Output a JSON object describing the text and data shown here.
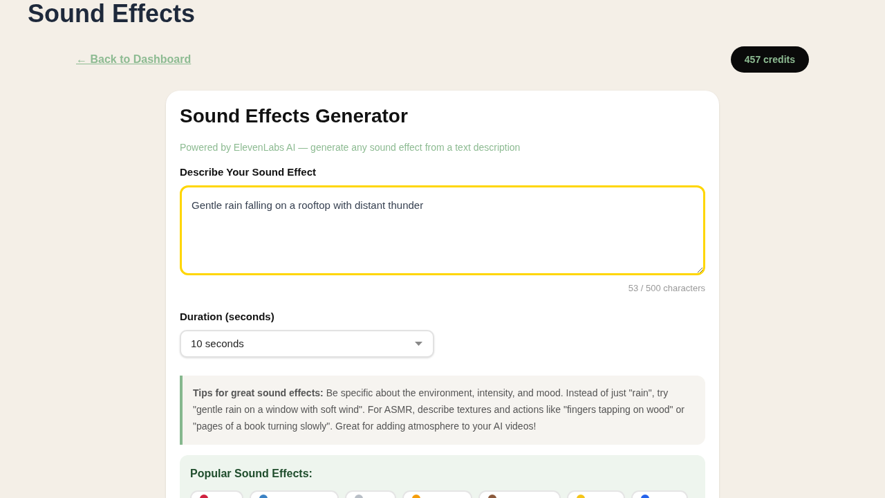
{
  "page": {
    "title": "Sound Effects"
  },
  "back_link": {
    "label": "← Back to Dashboard"
  },
  "credits": {
    "label": "457 credits"
  },
  "generator": {
    "title": "Sound Effects Generator",
    "subtitle": "Powered by ElevenLabs AI — generate any sound effect from a text description",
    "description": {
      "label": "Describe Your Sound Effect",
      "value": "Gentle rain falling on a rooftop with distant thunder",
      "focused": true,
      "counter": "53 / 500 characters"
    },
    "duration": {
      "label": "Duration (seconds)",
      "value": "10 seconds"
    },
    "tips": {
      "text": "**Tips for great sound effects:** Be specific about the environment, intensity, and mood. Instead of just \"rain\", try \"gentle rain on a window with soft wind\". For ASMR, describe textures and actions like \"fingers tapping on wood\" or \"pages of a book turning slowly\". Great for adding atmosphere to your AI videos!"
    },
    "popular": {
      "title": "Popular Sound Effects:"
    }
  }
}
